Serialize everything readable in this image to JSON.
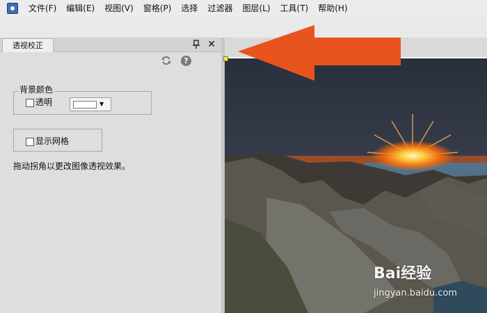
{
  "menubar": {
    "items": [
      "文件(F)",
      "编辑(E)",
      "视图(V)",
      "窗格(P)",
      "选择",
      "过滤器",
      "图层(L)",
      "工具(T)",
      "帮助(H)"
    ]
  },
  "panel": {
    "tab_title": "透视校正",
    "background_group": {
      "legend": "背景颜色",
      "transparent_label": "透明",
      "transparent_checked": false,
      "color_value": "#ffffff"
    },
    "grid": {
      "label": "显示网格",
      "checked": false
    },
    "hint": "拖动拐角以更改图像透视效果。"
  },
  "annotation": {
    "arrow_color": "#e8531e"
  },
  "watermark": {
    "main": "Bai经验",
    "sub": "jingyan.baidu.com"
  }
}
